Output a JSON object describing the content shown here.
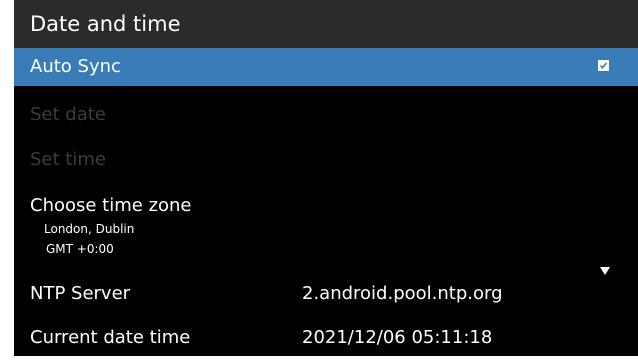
{
  "header": {
    "title": "Date and time"
  },
  "settings": {
    "auto_sync": {
      "label": "Auto Sync",
      "checked": true
    },
    "set_date": {
      "label": "Set date",
      "enabled": false
    },
    "set_time": {
      "label": "Set time",
      "enabled": false
    },
    "time_zone": {
      "label": "Choose time zone",
      "city": "London, Dublin",
      "offset": "GMT +0:00"
    },
    "ntp_server": {
      "label": "NTP Server",
      "value": "2.android.pool.ntp.org"
    },
    "current_date_time": {
      "label": "Current date time",
      "value": "2021/12/06 05:11:18"
    }
  },
  "colors": {
    "selection": "#3a7cb8",
    "title_bar": "#2b2b2b",
    "background": "#000000",
    "disabled_text": "#3c3c3c"
  },
  "icons": {
    "checkbox": "checkbox-checked-icon",
    "dropdown": "dropdown-arrow-icon"
  }
}
